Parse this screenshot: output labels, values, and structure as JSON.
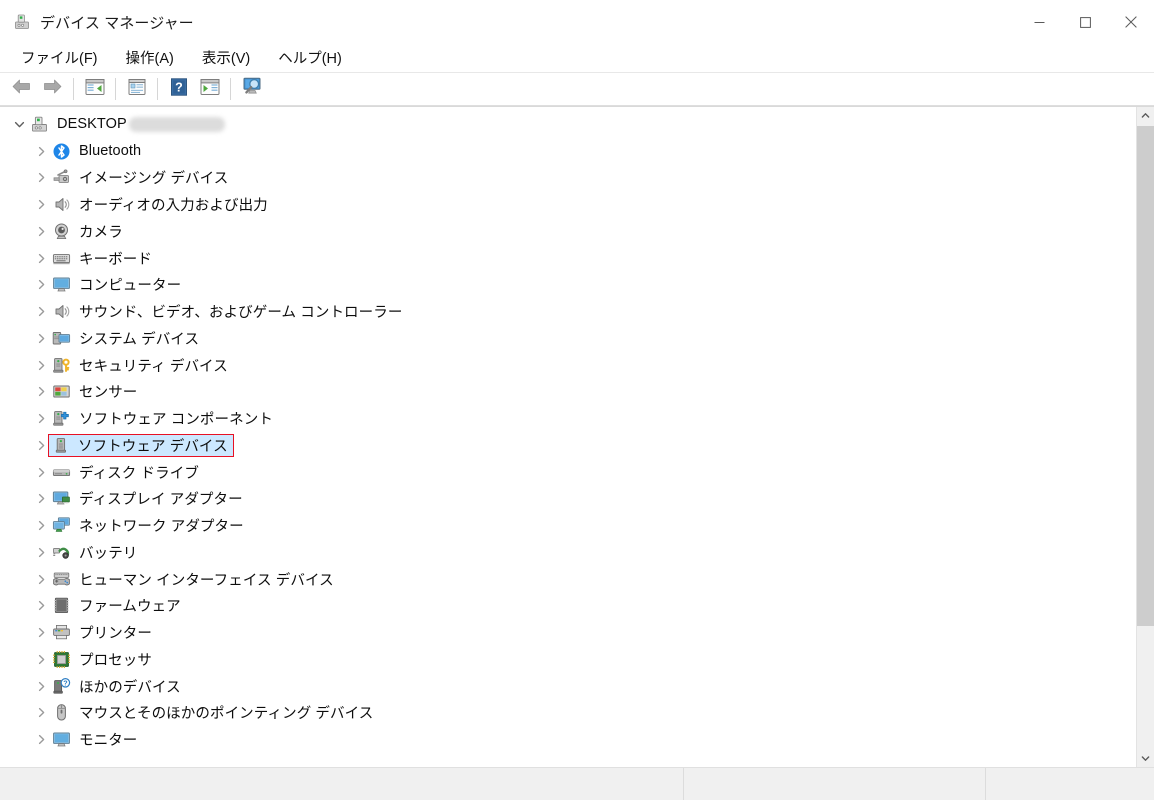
{
  "window": {
    "title": "デバイス マネージャー",
    "icon": "device-manager-icon",
    "minimize_label": "最小化",
    "maximize_label": "最大化",
    "close_label": "閉じる"
  },
  "menubar": {
    "items": [
      {
        "label": "ファイル(F)",
        "name": "menu-file"
      },
      {
        "label": "操作(A)",
        "name": "menu-action"
      },
      {
        "label": "表示(V)",
        "name": "menu-view"
      },
      {
        "label": "ヘルプ(H)",
        "name": "menu-help"
      }
    ]
  },
  "toolbar": {
    "buttons": [
      {
        "name": "back-button",
        "icon": "arrow-left-icon"
      },
      {
        "name": "forward-button",
        "icon": "arrow-right-icon"
      },
      {
        "separator_after": true
      },
      {
        "name": "show-hide-console-tree-button",
        "icon": "console-tree-icon"
      },
      {
        "separator_after": true
      },
      {
        "name": "properties-button",
        "icon": "properties-icon"
      },
      {
        "separator_after": true
      },
      {
        "name": "help-button",
        "icon": "help-question-icon"
      },
      {
        "name": "update-driver-button",
        "icon": "update-driver-icon"
      },
      {
        "separator_after": true
      },
      {
        "name": "scan-hardware-changes-button",
        "icon": "scan-hardware-icon"
      }
    ]
  },
  "tree": {
    "root": {
      "label": "DESKTOP",
      "redacted": true,
      "icon": "computer-device-icon",
      "expanded": true
    },
    "nodes": [
      {
        "label": "Bluetooth",
        "icon": "bluetooth-icon",
        "selected": false
      },
      {
        "label": "イメージング デバイス",
        "icon": "imaging-device-icon",
        "selected": false
      },
      {
        "label": "オーディオの入力および出力",
        "icon": "audio-io-icon",
        "selected": false
      },
      {
        "label": "カメラ",
        "icon": "camera-icon",
        "selected": false
      },
      {
        "label": "キーボード",
        "icon": "keyboard-icon",
        "selected": false
      },
      {
        "label": "コンピューター",
        "icon": "computer-icon",
        "selected": false
      },
      {
        "label": "サウンド、ビデオ、およびゲーム コントローラー",
        "icon": "sound-video-game-icon",
        "selected": false
      },
      {
        "label": "システム デバイス",
        "icon": "system-device-icon",
        "selected": false
      },
      {
        "label": "セキュリティ デバイス",
        "icon": "security-device-icon",
        "selected": false
      },
      {
        "label": "センサー",
        "icon": "sensor-icon",
        "selected": false
      },
      {
        "label": "ソフトウェア コンポーネント",
        "icon": "software-component-icon",
        "selected": false
      },
      {
        "label": "ソフトウェア デバイス",
        "icon": "software-device-icon",
        "selected": true
      },
      {
        "label": "ディスク ドライブ",
        "icon": "disk-drive-icon",
        "selected": false
      },
      {
        "label": "ディスプレイ アダプター",
        "icon": "display-adapter-icon",
        "selected": false
      },
      {
        "label": "ネットワーク アダプター",
        "icon": "network-adapter-icon",
        "selected": false
      },
      {
        "label": "バッテリ",
        "icon": "battery-icon",
        "selected": false
      },
      {
        "label": "ヒューマン インターフェイス デバイス",
        "icon": "hid-icon",
        "selected": false
      },
      {
        "label": "ファームウェア",
        "icon": "firmware-icon",
        "selected": false
      },
      {
        "label": "プリンター",
        "icon": "printer-icon",
        "selected": false
      },
      {
        "label": "プロセッサ",
        "icon": "processor-icon",
        "selected": false
      },
      {
        "label": "ほかのデバイス",
        "icon": "other-device-icon",
        "selected": false
      },
      {
        "label": "マウスとそのほかのポインティング デバイス",
        "icon": "mouse-icon",
        "selected": false
      },
      {
        "label": "モニター",
        "icon": "monitor-icon",
        "selected": false
      }
    ]
  },
  "scrollbar": {
    "up_label": "上にスクロール",
    "down_label": "下にスクロール"
  },
  "statusbar": {
    "cells": [
      "",
      "",
      ""
    ]
  },
  "colors": {
    "selection_background": "#cce8ff",
    "selection_outline": "#e81123",
    "window_background": "#ffffff",
    "statusbar_background": "#f0f0f0",
    "scrollbar_thumb": "#cdcdcd"
  }
}
